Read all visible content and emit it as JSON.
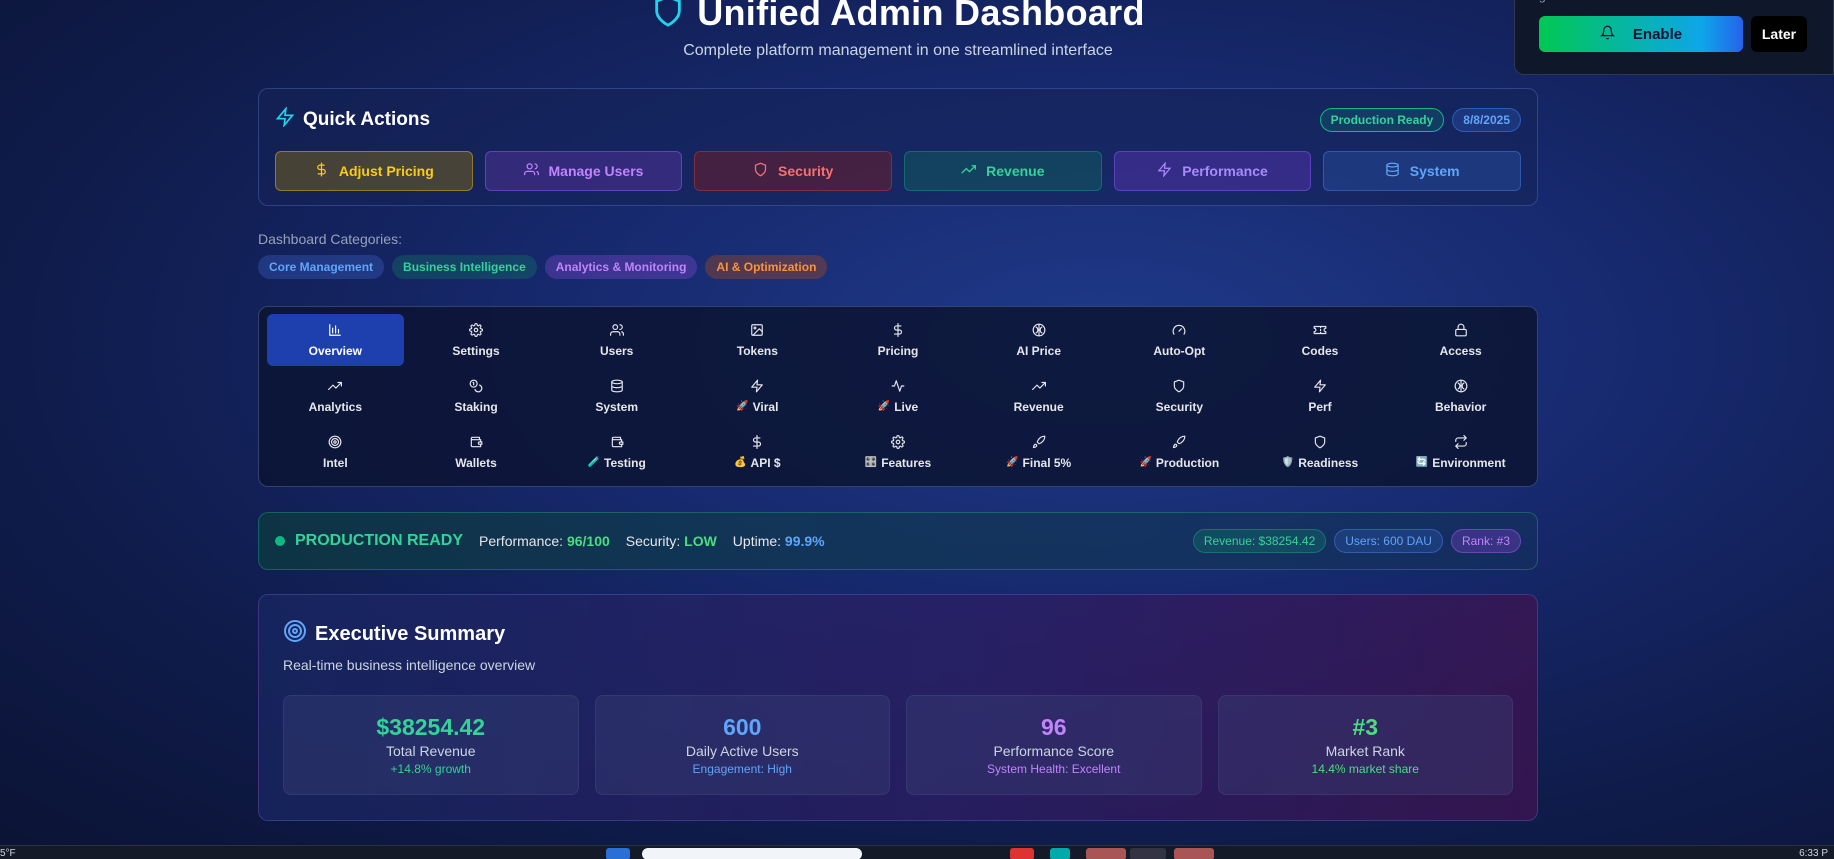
{
  "header": {
    "title": "Unified Admin Dashboard",
    "subtitle": "Complete platform management in one streamlined interface",
    "icon": "shield-icon"
  },
  "quick_actions": {
    "title": "Quick Actions",
    "badges": {
      "status": "Production Ready",
      "date": "8/8/2025"
    },
    "buttons": [
      {
        "label": "Adjust Pricing",
        "icon": "dollar-icon",
        "color": "#facc15"
      },
      {
        "label": "Manage Users",
        "icon": "users-icon",
        "color": "#c084fc"
      },
      {
        "label": "Security",
        "icon": "shield-icon",
        "color": "#f87171"
      },
      {
        "label": "Revenue",
        "icon": "trending-up-icon",
        "color": "#34d399"
      },
      {
        "label": "Performance",
        "icon": "zap-icon",
        "color": "#a78bfa"
      },
      {
        "label": "System",
        "icon": "database-icon",
        "color": "#60a5fa"
      }
    ]
  },
  "categories": {
    "label": "Dashboard Categories:",
    "items": [
      "Core Management",
      "Business Intelligence",
      "Analytics & Monitoring",
      "AI & Optimization"
    ]
  },
  "tabs": [
    {
      "label": "Overview",
      "icon": "bar-chart-icon",
      "active": true
    },
    {
      "label": "Settings",
      "icon": "gear-icon"
    },
    {
      "label": "Users",
      "icon": "users-icon"
    },
    {
      "label": "Tokens",
      "icon": "image-icon"
    },
    {
      "label": "Pricing",
      "icon": "dollar-icon"
    },
    {
      "label": "AI Price",
      "icon": "brain-icon"
    },
    {
      "label": "Auto-Opt",
      "icon": "gauge-icon"
    },
    {
      "label": "Codes",
      "icon": "ticket-icon"
    },
    {
      "label": "Access",
      "icon": "lock-icon"
    },
    {
      "label": "Analytics",
      "icon": "trending-up-icon"
    },
    {
      "label": "Staking",
      "icon": "coins-icon"
    },
    {
      "label": "System",
      "icon": "database-icon"
    },
    {
      "label": "Viral",
      "icon": "zap-icon",
      "prefix": "🚀"
    },
    {
      "label": "Live",
      "icon": "activity-icon",
      "prefix": "🚀"
    },
    {
      "label": "Revenue",
      "icon": "trending-up-icon"
    },
    {
      "label": "Security",
      "icon": "shield-icon"
    },
    {
      "label": "Perf",
      "icon": "zap-icon"
    },
    {
      "label": "Behavior",
      "icon": "brain-icon"
    },
    {
      "label": "Intel",
      "icon": "target-icon"
    },
    {
      "label": "Wallets",
      "icon": "wallet-icon"
    },
    {
      "label": "Testing",
      "icon": "wallet-icon",
      "prefix": "🧪"
    },
    {
      "label": "API $",
      "icon": "dollar-icon",
      "prefix": "💰"
    },
    {
      "label": "Features",
      "icon": "gear-icon",
      "prefix": "🎛️"
    },
    {
      "label": "Final 5%",
      "icon": "rocket-icon",
      "prefix": "🚀"
    },
    {
      "label": "Production",
      "icon": "rocket-icon",
      "prefix": "🚀"
    },
    {
      "label": "Readiness",
      "icon": "shield-icon",
      "prefix": "🛡️"
    },
    {
      "label": "Environment",
      "icon": "arrows-icon",
      "prefix": "🔄"
    }
  ],
  "production": {
    "title": "PRODUCTION READY",
    "performance_label": "Performance:",
    "performance_value": "96/100",
    "security_label": "Security:",
    "security_value": "LOW",
    "uptime_label": "Uptime:",
    "uptime_value": "99.9%",
    "badges": {
      "revenue": "Revenue: $38254.42",
      "users": "Users: 600 DAU",
      "rank": "Rank: #3"
    }
  },
  "executive": {
    "title": "Executive Summary",
    "subtitle": "Real-time business intelligence overview",
    "cards": [
      {
        "value": "$38254.42",
        "label": "Total Revenue",
        "note": "+14.8% growth",
        "color": "#34d399"
      },
      {
        "value": "600",
        "label": "Daily Active Users",
        "note": "Engagement: High",
        "color": "#60a5fa"
      },
      {
        "value": "96",
        "label": "Performance Score",
        "note": "System Health: Excellent",
        "color": "#c084fc"
      },
      {
        "value": "#3",
        "label": "Market Rank",
        "note": "14.4% market share",
        "color": "#4ade80"
      }
    ]
  },
  "notification": {
    "text": "g",
    "enable_label": "Enable",
    "later_label": "Later"
  },
  "taskbar": {
    "left_text": "5°F",
    "right_text": "6:33 P"
  }
}
